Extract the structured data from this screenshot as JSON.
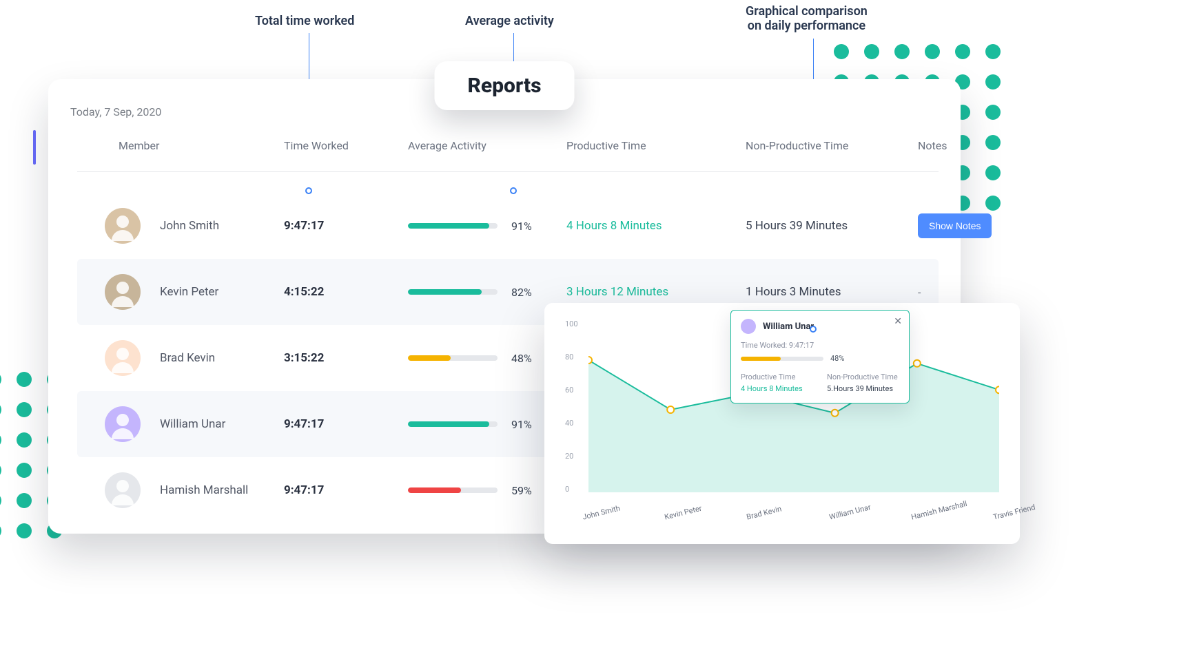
{
  "annotations": {
    "time_worked": "Total time worked",
    "avg_activity": "Average activity",
    "graph_compare": "Graphical comparison\non daily performance"
  },
  "title": "Reports",
  "date": "Today, 7 Sep, 2020",
  "columns": {
    "member": "Member",
    "time_worked": "Time Worked",
    "avg_activity": "Average Activity",
    "productive": "Productive Time",
    "nonproductive": "Non-Productive Time",
    "notes": "Notes"
  },
  "rows": [
    {
      "name": "John Smith",
      "time_worked": "9:47:17",
      "activity_pct": 91,
      "activity_color": "#1abc9c",
      "productive": "4 Hours 8 Minutes",
      "nonproductive": "5 Hours 39 Minutes",
      "notes_button": "Show Notes",
      "alt": false,
      "avatar_bg": "#d9c3a5"
    },
    {
      "name": "Kevin Peter",
      "time_worked": "4:15:22",
      "activity_pct": 82,
      "activity_color": "#1abc9c",
      "productive": "3 Hours 12 Minutes",
      "nonproductive": "1 Hours 3 Minutes",
      "notes_text": "-",
      "alt": true,
      "avatar_bg": "#c7b59a"
    },
    {
      "name": "Brad Kevin",
      "time_worked": "3:15:22",
      "activity_pct": 48,
      "activity_color": "#f5b301",
      "productive": "",
      "nonproductive": "",
      "notes_text": "",
      "alt": false,
      "avatar_bg": "#fde2cf"
    },
    {
      "name": "William Unar",
      "time_worked": "9:47:17",
      "activity_pct": 91,
      "activity_color": "#1abc9c",
      "productive": "",
      "nonproductive": "",
      "notes_text": "",
      "alt": true,
      "avatar_bg": "#c4b5fd"
    },
    {
      "name": "Hamish Marshall",
      "time_worked": "9:47:17",
      "activity_pct": 59,
      "activity_color": "#ef4444",
      "productive": "",
      "nonproductive": "",
      "notes_text": "",
      "alt": false,
      "avatar_bg": "#e5e7eb"
    }
  ],
  "chart_data": {
    "type": "area",
    "title": "",
    "xlabel": "",
    "ylabel": "",
    "ylim": [
      0,
      100
    ],
    "yticks": [
      0,
      20,
      40,
      60,
      80,
      100
    ],
    "categories": [
      "John Smith",
      "Kevin Peter",
      "Brad Kevin",
      "William Unar",
      "Hamish Marshall",
      "Travis Friend"
    ],
    "values": [
      80,
      50,
      60,
      48,
      78,
      62
    ],
    "series_color": "#1abc9c",
    "marker_stroke": "#f5b301"
  },
  "tooltip": {
    "name": "William Unar",
    "time_worked_label": "Time Worked: 9:47:17",
    "pct": 48,
    "col1_label": "Productive Time",
    "col1_value": "4 Hours 8 Minutes",
    "col2_label": "Non-Productive Time",
    "col2_value": "5.Hours 39 Minutes"
  },
  "colors": {
    "accent": "#1abc9c",
    "blue": "#4f8cff"
  }
}
